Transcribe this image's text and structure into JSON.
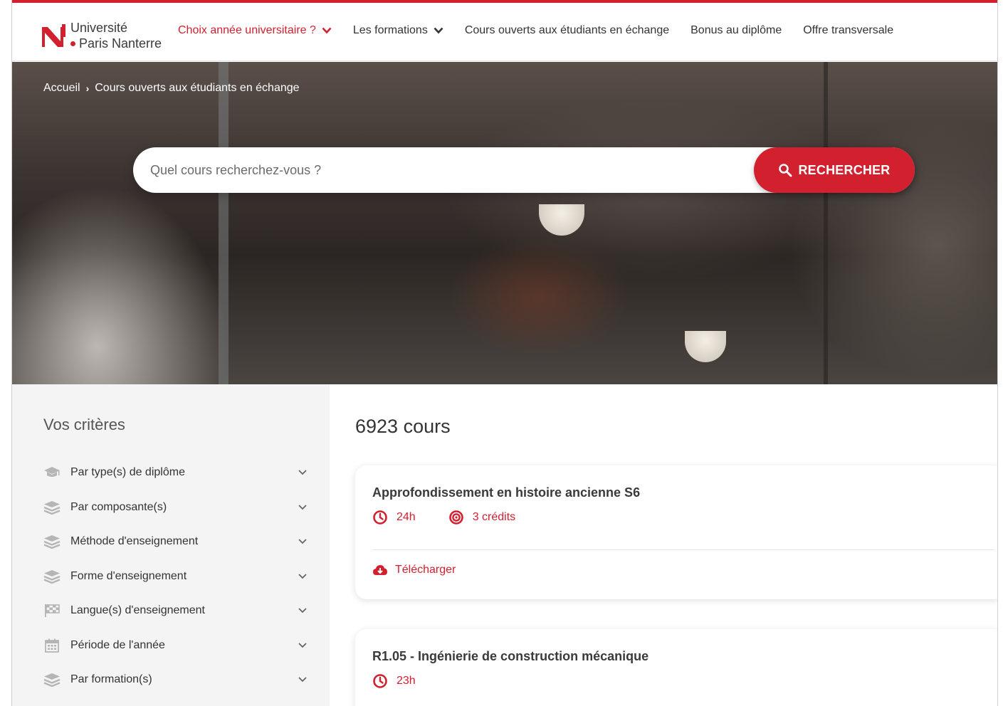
{
  "brand": {
    "line1": "Université",
    "line2": "Paris Nanterre",
    "accent_color": "#d2202f"
  },
  "nav": {
    "items": [
      {
        "label": "Choix année universitaire ?",
        "dropdown": true,
        "active": true
      },
      {
        "label": "Les formations",
        "dropdown": true,
        "active": false
      },
      {
        "label": "Cours ouverts aux étudiants en échange",
        "dropdown": false,
        "active": false
      },
      {
        "label": "Bonus au diplôme",
        "dropdown": false,
        "active": false
      },
      {
        "label": "Offre transversale",
        "dropdown": false,
        "active": false
      }
    ]
  },
  "breadcrumb": {
    "home": "Accueil",
    "current": "Cours ouverts aux étudiants en échange"
  },
  "search": {
    "placeholder": "Quel cours recherchez-vous ?",
    "button_label": "RECHERCHER"
  },
  "filters": {
    "title": "Vos critères",
    "items": [
      {
        "label": "Par type(s) de diplôme",
        "icon": "graduation-cap-icon"
      },
      {
        "label": "Par composante(s)",
        "icon": "layers-icon"
      },
      {
        "label": "Méthode d'enseignement",
        "icon": "layers-icon"
      },
      {
        "label": "Forme d'enseignement",
        "icon": "layers-icon"
      },
      {
        "label": "Langue(s) d'enseignement",
        "icon": "flag-icon"
      },
      {
        "label": "Période de l'année",
        "icon": "calendar-icon"
      },
      {
        "label": "Par formation(s)",
        "icon": "layers-icon"
      }
    ]
  },
  "results": {
    "count_label": "6923 cours",
    "courses": [
      {
        "title": "Approfondissement en histoire ancienne S6",
        "hours": "24h",
        "credits": "3 crédits",
        "download_label": "Télécharger"
      },
      {
        "title": "R1.05 - Ingénierie de construction mécanique",
        "hours": "23h"
      }
    ]
  }
}
